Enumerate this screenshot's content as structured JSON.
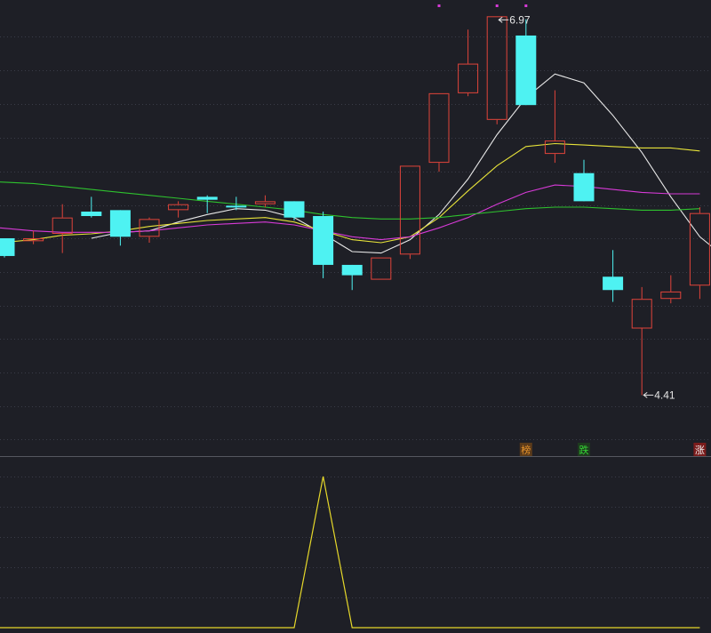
{
  "colors": {
    "background": "#1e1f26",
    "grid": "#3a3c48",
    "separator": "#55575f",
    "up": "#e0443a",
    "down": "#4ef2f2",
    "ma_white": "#e8e8e8",
    "ma_yellow": "#e8e43a",
    "ma_magenta": "#d73ad7",
    "ma_green": "#2ec12e",
    "indicator": "#e6d82a",
    "marker": "#d73ad7"
  },
  "chart_data": [
    {
      "type": "candlestick",
      "title": "",
      "ylim": [
        4.1,
        7.05
      ],
      "candles": [
        {
          "o": 5.47,
          "c": 5.35,
          "h": 5.47,
          "l": 5.34
        },
        {
          "o": 5.45,
          "c": 5.47,
          "h": 5.52,
          "l": 5.43
        },
        {
          "o": 5.5,
          "c": 5.61,
          "h": 5.7,
          "l": 5.37
        },
        {
          "o": 5.65,
          "c": 5.62,
          "h": 5.75,
          "l": 5.61
        },
        {
          "o": 5.66,
          "c": 5.48,
          "h": 5.66,
          "l": 5.42
        },
        {
          "o": 5.48,
          "c": 5.6,
          "h": 5.61,
          "l": 5.44
        },
        {
          "o": 5.66,
          "c": 5.7,
          "h": 5.72,
          "l": 5.61
        },
        {
          "o": 5.75,
          "c": 5.73,
          "h": 5.76,
          "l": 5.64
        },
        {
          "o": 5.69,
          "c": 5.68,
          "h": 5.75,
          "l": 5.66
        },
        {
          "o": 5.7,
          "c": 5.72,
          "h": 5.76,
          "l": 5.68
        },
        {
          "o": 5.72,
          "c": 5.61,
          "h": 5.72,
          "l": 5.59
        },
        {
          "o": 5.62,
          "c": 5.29,
          "h": 5.65,
          "l": 5.2
        },
        {
          "o": 5.29,
          "c": 5.22,
          "h": 5.29,
          "l": 5.12
        },
        {
          "o": 5.19,
          "c": 5.34,
          "h": 5.34,
          "l": 5.19
        },
        {
          "o": 5.36,
          "c": 5.96,
          "h": 5.96,
          "l": 5.33
        },
        {
          "o": 5.98,
          "c": 6.45,
          "h": 6.45,
          "l": 5.92
        },
        {
          "o": 6.45,
          "c": 6.65,
          "h": 6.88,
          "l": 6.43
        },
        {
          "o": 6.27,
          "c": 6.97,
          "h": 6.97,
          "l": 6.24
        },
        {
          "o": 6.84,
          "c": 6.37,
          "h": 6.95,
          "l": 6.37
        },
        {
          "o": 6.04,
          "c": 6.13,
          "h": 6.47,
          "l": 5.98
        },
        {
          "o": 5.91,
          "c": 5.72,
          "h": 6.0,
          "l": 5.72
        },
        {
          "o": 5.21,
          "c": 5.12,
          "h": 5.39,
          "l": 5.04
        },
        {
          "o": 4.86,
          "c": 5.06,
          "h": 5.14,
          "l": 4.41
        },
        {
          "o": 5.06,
          "c": 5.11,
          "h": 5.22,
          "l": 5.03
        },
        {
          "o": 5.15,
          "c": 5.64,
          "h": 5.68,
          "l": 5.06
        }
      ],
      "ma_lines": [
        {
          "color": "ma_white",
          "start": 3,
          "values": [
            5.47,
            5.51,
            5.52,
            5.58,
            5.63,
            5.67,
            5.66,
            5.61,
            5.5,
            5.38,
            5.37,
            5.46,
            5.63,
            5.87,
            6.17,
            6.42,
            6.58,
            6.52,
            6.3,
            6.05,
            5.75,
            5.48,
            5.32
          ]
        },
        {
          "color": "ma_yellow",
          "start": 0,
          "values": [
            5.44,
            5.46,
            5.49,
            5.5,
            5.52,
            5.55,
            5.57,
            5.59,
            5.6,
            5.61,
            5.58,
            5.52,
            5.46,
            5.44,
            5.48,
            5.61,
            5.79,
            5.96,
            6.09,
            6.11,
            6.1,
            6.09,
            6.08,
            6.08,
            6.06
          ]
        },
        {
          "color": "ma_magenta",
          "start": 0,
          "values": [
            5.54,
            5.52,
            5.51,
            5.51,
            5.51,
            5.52,
            5.54,
            5.56,
            5.57,
            5.58,
            5.56,
            5.52,
            5.48,
            5.46,
            5.48,
            5.54,
            5.61,
            5.7,
            5.78,
            5.83,
            5.82,
            5.8,
            5.78,
            5.77,
            5.77
          ]
        },
        {
          "color": "ma_green",
          "start": 0,
          "values": [
            5.85,
            5.84,
            5.82,
            5.8,
            5.78,
            5.76,
            5.74,
            5.72,
            5.7,
            5.68,
            5.66,
            5.63,
            5.61,
            5.6,
            5.6,
            5.61,
            5.63,
            5.65,
            5.67,
            5.68,
            5.68,
            5.67,
            5.66,
            5.66,
            5.67
          ]
        }
      ],
      "annotations": [
        {
          "text": "6.97",
          "index": 17,
          "value": 6.97
        },
        {
          "text": "4.41",
          "index": 22,
          "value": 4.41
        }
      ],
      "markers": [
        15,
        17,
        18
      ],
      "tags": [
        {
          "text": "榜",
          "index": 18,
          "color": "#e6922a",
          "bg": "#5a3a1a"
        },
        {
          "text": "跌",
          "index": 20,
          "color": "#35d835",
          "bg": "#1e3a1e"
        },
        {
          "text": "涨",
          "index": 24,
          "color": "#f0f0f0",
          "bg": "#7a1c1c"
        }
      ]
    },
    {
      "type": "line",
      "title": "",
      "ylim": [
        0,
        1
      ],
      "series": [
        {
          "color": "indicator",
          "values": [
            0,
            0,
            0,
            0,
            0,
            0,
            0,
            0,
            0,
            0,
            0,
            1,
            0,
            0,
            0,
            0,
            0,
            0,
            0,
            0,
            0,
            0,
            0,
            0,
            0
          ]
        }
      ]
    }
  ]
}
